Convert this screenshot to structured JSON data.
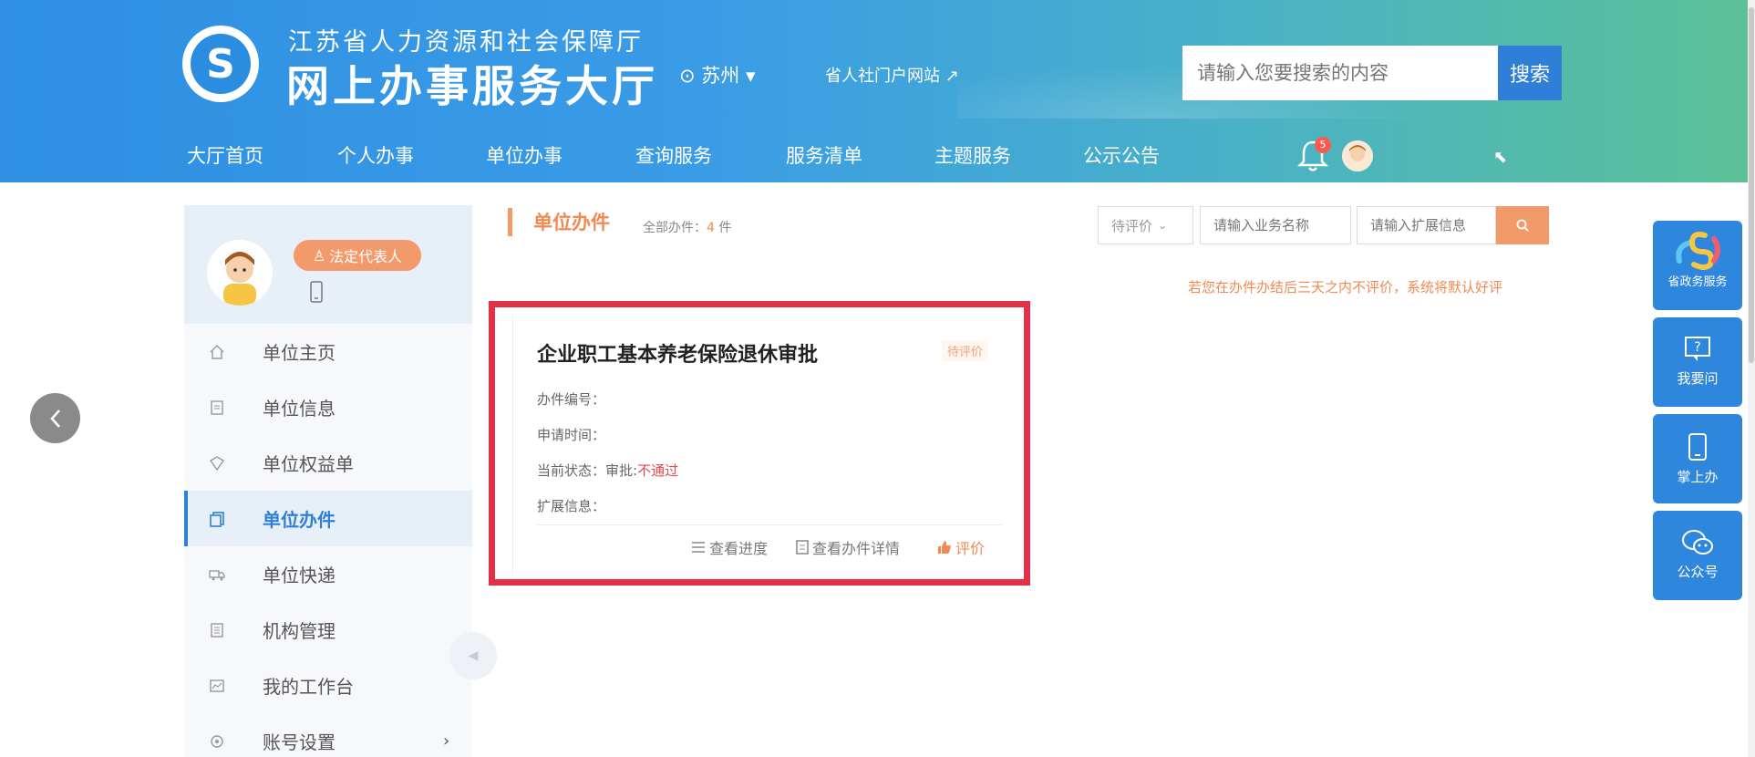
{
  "header": {
    "org_name": "江苏省人力资源和社会保障厅",
    "hall_title": "网上办事服务大厅",
    "city": "苏州",
    "portal_link": "省人社门户网站",
    "search": {
      "placeholder": "请输入您要搜索的内容",
      "button": "搜索"
    },
    "nav": [
      "大厅首页",
      "个人办事",
      "单位办事",
      "查询服务",
      "服务清单",
      "主题服务",
      "公示公告"
    ],
    "notification_count": "5"
  },
  "sidebar": {
    "role_badge": "法定代表人",
    "items": [
      {
        "label": "单位主页",
        "icon": "home-icon"
      },
      {
        "label": "单位信息",
        "icon": "document-icon"
      },
      {
        "label": "单位权益单",
        "icon": "shield-icon"
      },
      {
        "label": "单位办件",
        "icon": "files-icon",
        "active": true
      },
      {
        "label": "单位快递",
        "icon": "truck-icon"
      },
      {
        "label": "机构管理",
        "icon": "building-icon"
      },
      {
        "label": "我的工作台",
        "icon": "chart-icon"
      },
      {
        "label": "账号设置",
        "icon": "settings-icon",
        "chevron": "›"
      }
    ]
  },
  "main": {
    "section_title": "单位办件",
    "total_label": "全部办件：",
    "total_count": "4",
    "total_unit": "件",
    "filters": {
      "status_select": "待评价",
      "business_name_placeholder": "请输入业务名称",
      "extension_placeholder": "请输入扩展信息"
    },
    "notice": "若您在办件办结后三天之内不评价，系统将默认好评",
    "card": {
      "title": "企业职工基本养老保险退休审批",
      "status": "待评价",
      "fields": {
        "number_label": "办件编号：",
        "time_label": "申请时间：",
        "state_label": "当前状态：",
        "state_prefix": "审批:",
        "state_value": "不通过",
        "ext_label": "扩展信息："
      },
      "actions": {
        "progress": "查看进度",
        "detail": "查看办件详情",
        "rate": "评价"
      }
    }
  },
  "float_toolbar": [
    {
      "label": "省政务服务",
      "icon": "gov-service-icon"
    },
    {
      "label": "我要问",
      "icon": "question-icon"
    },
    {
      "label": "掌上办",
      "icon": "mobile-icon"
    },
    {
      "label": "公众号",
      "icon": "wechat-icon"
    }
  ],
  "colors": {
    "primary": "#2f7fd8",
    "accent": "#f39a6b",
    "highlight": "#e23049"
  }
}
